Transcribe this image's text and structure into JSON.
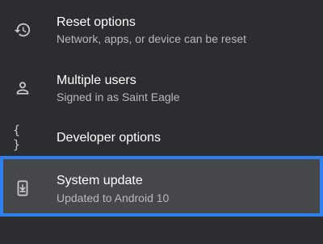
{
  "settings": {
    "items": [
      {
        "icon": "history-icon",
        "title": "Reset options",
        "subtitle": "Network, apps, or device can be reset"
      },
      {
        "icon": "person-icon",
        "title": "Multiple users",
        "subtitle": "Signed in as Saint Eagle"
      },
      {
        "icon": "braces-icon",
        "icon_text": "{ }",
        "title": "Developer options"
      },
      {
        "icon": "system-update-icon",
        "title": "System update",
        "subtitle": "Updated to Android 10",
        "selected": true
      }
    ]
  },
  "colors": {
    "background": "#2b2d30",
    "selected_background": "#45474b",
    "focus_outline": "#2e80ef",
    "title_text": "#ffffff",
    "subtitle_text": "#b7babf"
  }
}
